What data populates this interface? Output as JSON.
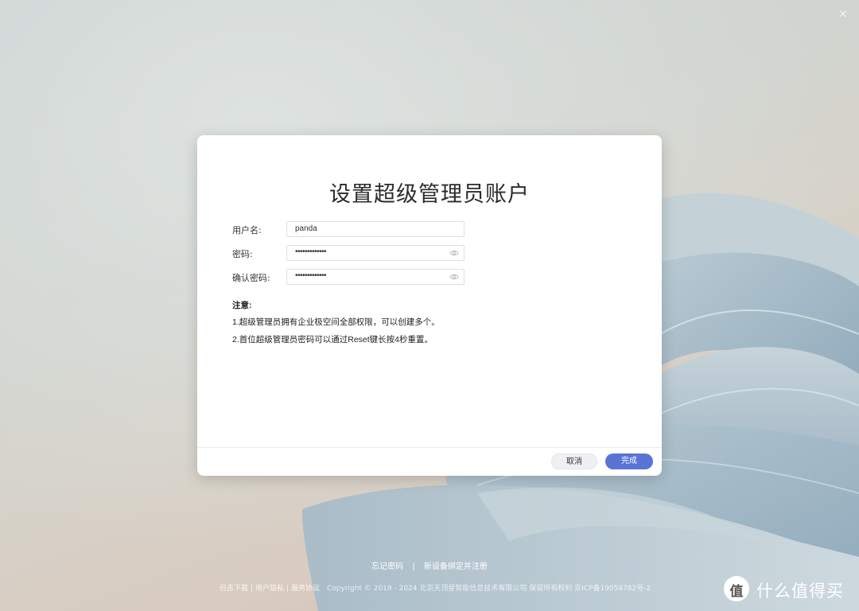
{
  "window": {
    "close_glyph": "×"
  },
  "dialog": {
    "title": "设置超级管理员账户",
    "fields": [
      {
        "label": "用户名:",
        "value": "panda",
        "type": "text"
      },
      {
        "label": "密码:",
        "value": "•••••••••••••",
        "type": "password",
        "icon": "eye-icon"
      },
      {
        "label": "确认密码:",
        "value": "•••••••••••••",
        "type": "password",
        "icon": "eye-icon"
      }
    ],
    "notes": {
      "title": "注意:",
      "lines": [
        "1.超级管理员拥有企业极空间全部权限，可以创建多个。",
        "2.首位超级管理员密码可以通过Reset键长按4秒重置。"
      ]
    },
    "buttons": {
      "cancel": "取消",
      "confirm": "完成"
    },
    "colors": {
      "confirm_bg": "#5a74d6"
    }
  },
  "bottom": {
    "forgot_password": "忘记密码",
    "separator": "|",
    "bind_register": "新设备绑定并注册"
  },
  "footer": {
    "log_download": "日志下载",
    "privacy": "用户隐私",
    "terms": "服务协议",
    "bar": "|",
    "copyright": "Copyright © 2019 - 2024 北京天顶星智能信息技术有限公司 保留所有权利 京ICP备19054782号-2"
  },
  "watermark": {
    "logo_char": "值",
    "text": "什么值得买"
  }
}
